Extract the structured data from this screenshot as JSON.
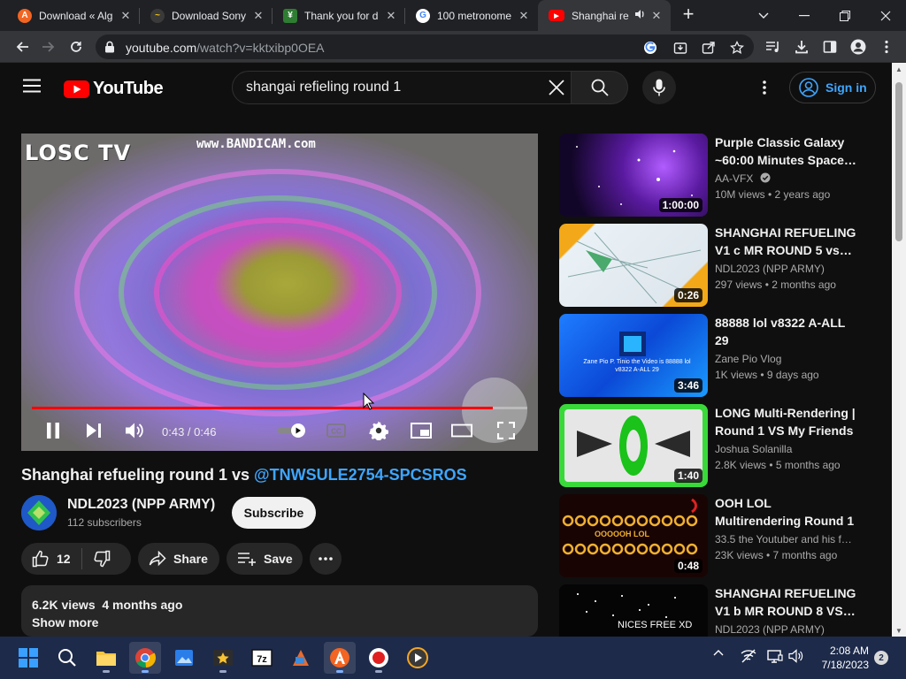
{
  "browser": {
    "tabs": [
      {
        "title": "Download « Alg",
        "favicon_color": "#f26522",
        "favicon_glyph": "A"
      },
      {
        "title": "Download Sony",
        "favicon_color": "#3a3a3a",
        "favicon_glyph": "~"
      },
      {
        "title": "Thank you for d",
        "favicon_color": "#2e7d32",
        "favicon_glyph": "¥"
      },
      {
        "title": "100 metronome",
        "favicon_color": "#ffffff",
        "favicon_glyph": "G"
      },
      {
        "title": "Shanghai re",
        "favicon_color": "#ff0000",
        "favicon_glyph": "▶",
        "active": true,
        "audio_icon": "speaker-icon"
      }
    ],
    "new_tab_glyph": "+",
    "url_host": "youtube.com",
    "url_path": "/watch?v=kktxibp0OEA"
  },
  "youtube": {
    "logo_text": "YouTube",
    "search_value": "shangai refieling round 1",
    "signin_label": "Sign in"
  },
  "player": {
    "watermark_logo": "LOSC TV",
    "watermark_bandicam": "www.BANDICAM.com",
    "current_time": "0:43",
    "duration": "0:46",
    "time_display": "0:43 / 0:46",
    "progress_fraction": 0.93
  },
  "video": {
    "title_prefix": "Shanghai refueling round 1 vs ",
    "title_mention": "@TNWSULE2754-SPCSROS",
    "channel_name": "NDL2023 (NPP ARMY)",
    "subscribers": "112 subscribers",
    "subscribe_label": "Subscribe",
    "likes": "12",
    "share_label": "Share",
    "save_label": "Save",
    "views_and_date": "6.2K views  4 months ago",
    "show_more_label": "Show more"
  },
  "recommendations": [
    {
      "title": "Purple Classic Galaxy ~60:00 Minutes Space…",
      "channel": "AA-VFX",
      "verified": true,
      "meta": "10M views  •  2 years ago",
      "duration": "1:00:00"
    },
    {
      "title": "SHANGHAI REFUELING V1 c MR ROUND 5 vs…",
      "channel": "NDL2023 (NPP ARMY)",
      "meta": "297 views  •  2 months ago",
      "duration": "0:26"
    },
    {
      "title": "88888 lol v8322 A-ALL 29",
      "channel": "Zane Pio Vlog",
      "meta": "1K views  •  9 days ago",
      "duration": "3:46",
      "thumb_text": "Zane Pio P. Tinio the Video is 88888 lol v8322 A-ALL 29"
    },
    {
      "title": "LONG Multi-Rendering | Round 1 VS My Friends",
      "channel": "Joshua Solanilla",
      "meta": "2.8K views  •  5 months ago",
      "duration": "1:40"
    },
    {
      "title": "OOH LOL Multirendering Round 1",
      "channel": "33.5 the Youtuber and his f…",
      "meta": "23K views  •  7 months ago",
      "duration": "0:48",
      "thumb_text": "OOOOOH LOL"
    },
    {
      "title": "SHANGHAI REFUELING V1 b MR ROUND 8 VS…",
      "channel": "NDL2023 (NPP ARMY)",
      "meta": "",
      "duration": "",
      "thumb_text": "NICES FREE XD"
    }
  ],
  "taskbar": {
    "time": "2:08 AM",
    "date": "7/18/2023",
    "notification_count": "2"
  }
}
